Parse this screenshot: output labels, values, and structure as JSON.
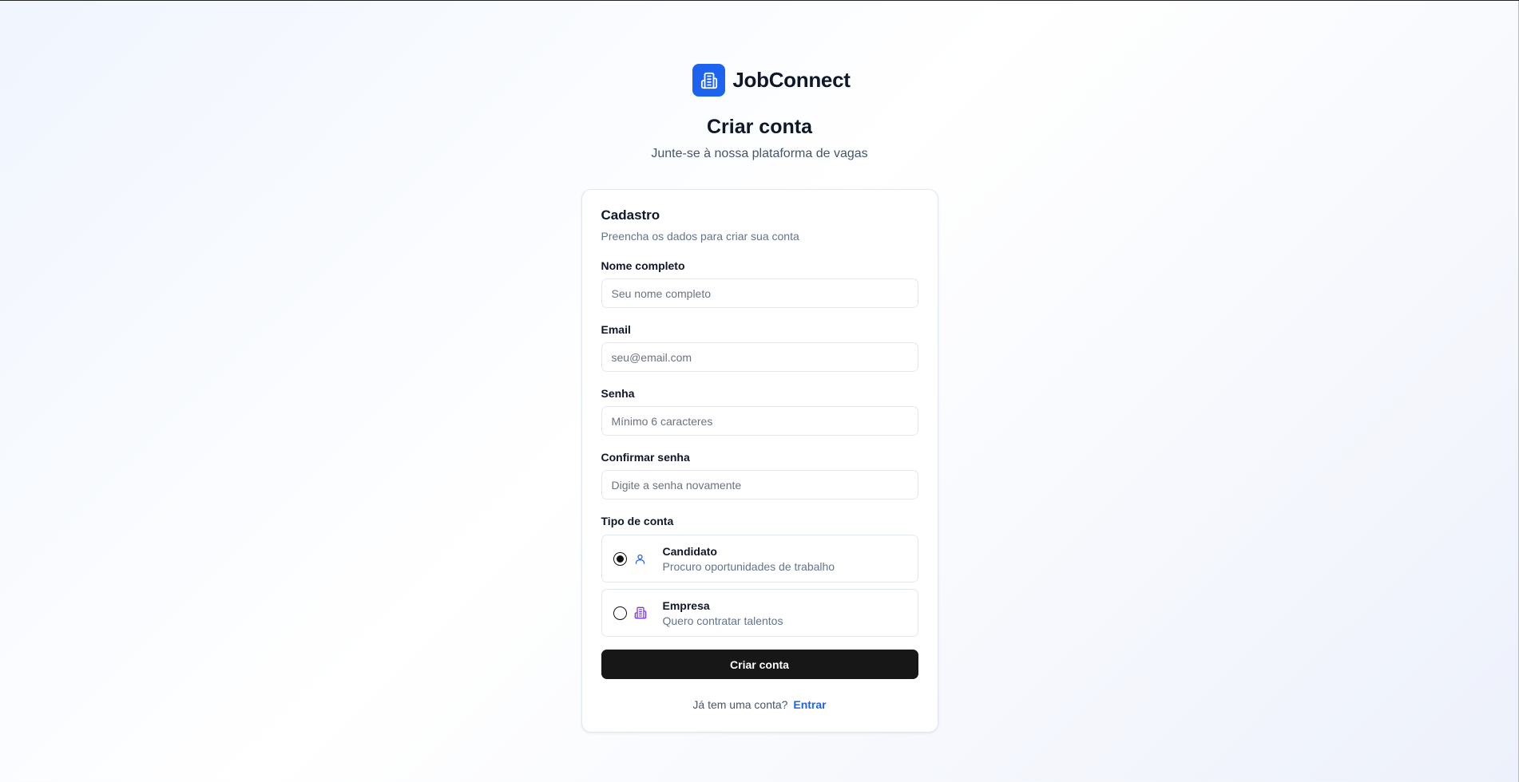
{
  "brand": {
    "name": "JobConnect",
    "logo_icon": "building-icon",
    "accent_color": "#1d63ed"
  },
  "header": {
    "title": "Criar conta",
    "subtitle": "Junte-se à nossa plataforma de vagas"
  },
  "card": {
    "title": "Cadastro",
    "description": "Preencha os dados para criar sua conta",
    "fields": {
      "name": {
        "label": "Nome completo",
        "placeholder": "Seu nome completo",
        "value": ""
      },
      "email": {
        "label": "Email",
        "placeholder": "seu@email.com",
        "value": ""
      },
      "password": {
        "label": "Senha",
        "placeholder": "Mínimo 6 caracteres",
        "value": ""
      },
      "confirm": {
        "label": "Confirmar senha",
        "placeholder": "Digite a senha novamente",
        "value": ""
      }
    },
    "account_type": {
      "label": "Tipo de conta",
      "selected": "candidato",
      "options": [
        {
          "id": "candidato",
          "title": "Candidato",
          "subtitle": "Procuro oportunidades de trabalho",
          "icon": "user-icon",
          "icon_color": "#1d63ed"
        },
        {
          "id": "empresa",
          "title": "Empresa",
          "subtitle": "Quero contratar talentos",
          "icon": "building-icon",
          "icon_color": "#7c3aed"
        }
      ]
    },
    "submit_label": "Criar conta",
    "footer": {
      "prompt": "Já tem uma conta?",
      "link_label": "Entrar"
    }
  }
}
